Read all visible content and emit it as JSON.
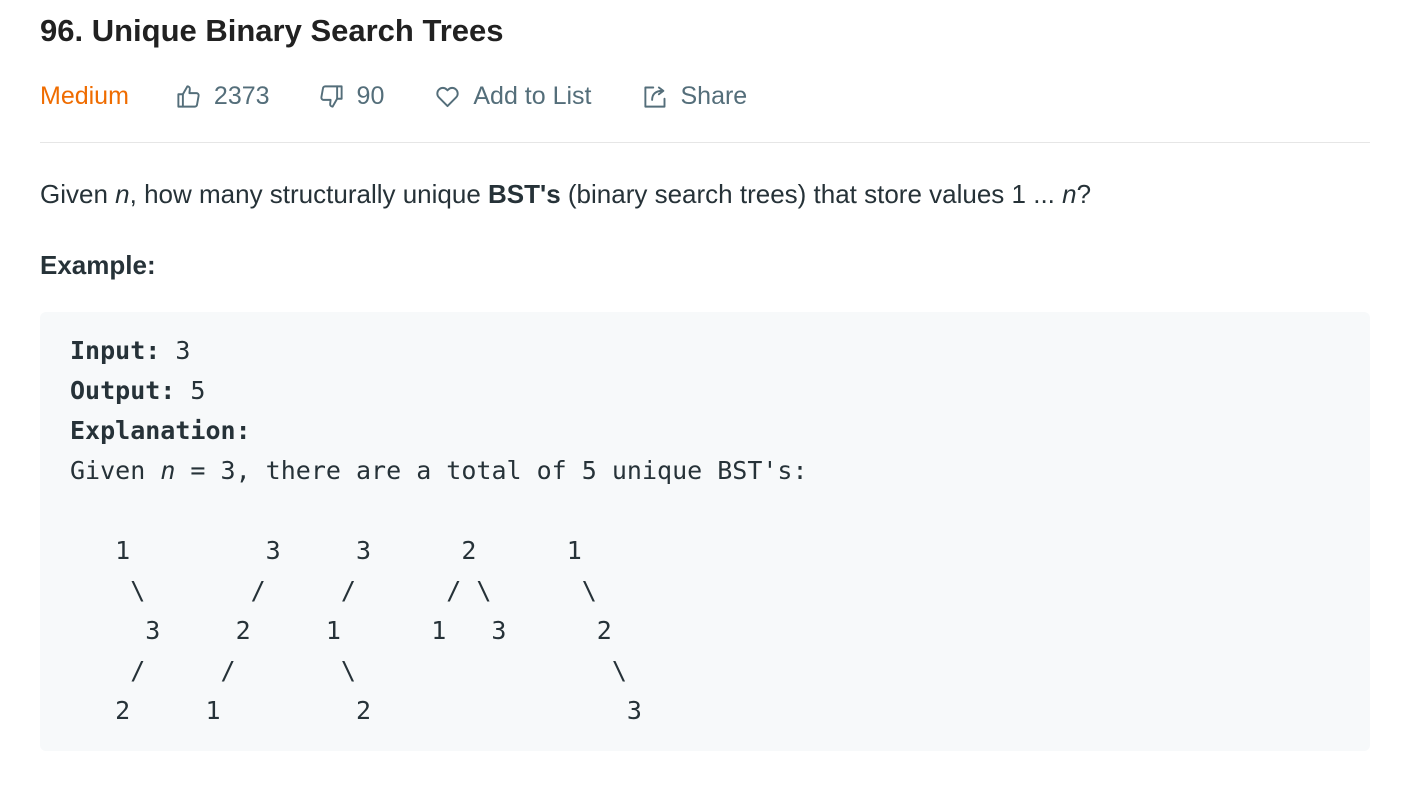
{
  "problem": {
    "title": "96. Unique Binary Search Trees",
    "difficulty": "Medium",
    "likes": "2373",
    "dislikes": "90",
    "add_to_list_label": "Add to List",
    "share_label": "Share"
  },
  "description": {
    "p1": "Given ",
    "var_n": "n",
    "p2": ", how many structurally unique ",
    "bst_bold": "BST's",
    "p3": " (binary search trees) that store values 1 ... ",
    "var_n2": "n",
    "p4": "?"
  },
  "example": {
    "heading": "Example:",
    "input_label": "Input:",
    "input_value": " 3",
    "output_label": "Output:",
    "output_value": " 5",
    "explanation_label": "Explanation:",
    "given_prefix": "Given ",
    "given_var": "n",
    "given_suffix": " = 3, there are a total of 5 unique BST's:",
    "tree_lines": [
      "",
      "   1         3     3      2      1",
      "    \\       /     /      / \\      \\",
      "     3     2     1      1   3      2",
      "    /     /       \\                 \\",
      "   2     1         2                 3"
    ]
  },
  "colors": {
    "difficulty": "#ef6c00",
    "meta_text": "#546e7a",
    "code_background": "#f7f9fa",
    "divider": "#e6e6e6"
  },
  "icons": {
    "likes": "thumbs-up-icon",
    "dislikes": "thumbs-down-icon",
    "add_to_list": "heart-icon",
    "share": "share-icon"
  }
}
